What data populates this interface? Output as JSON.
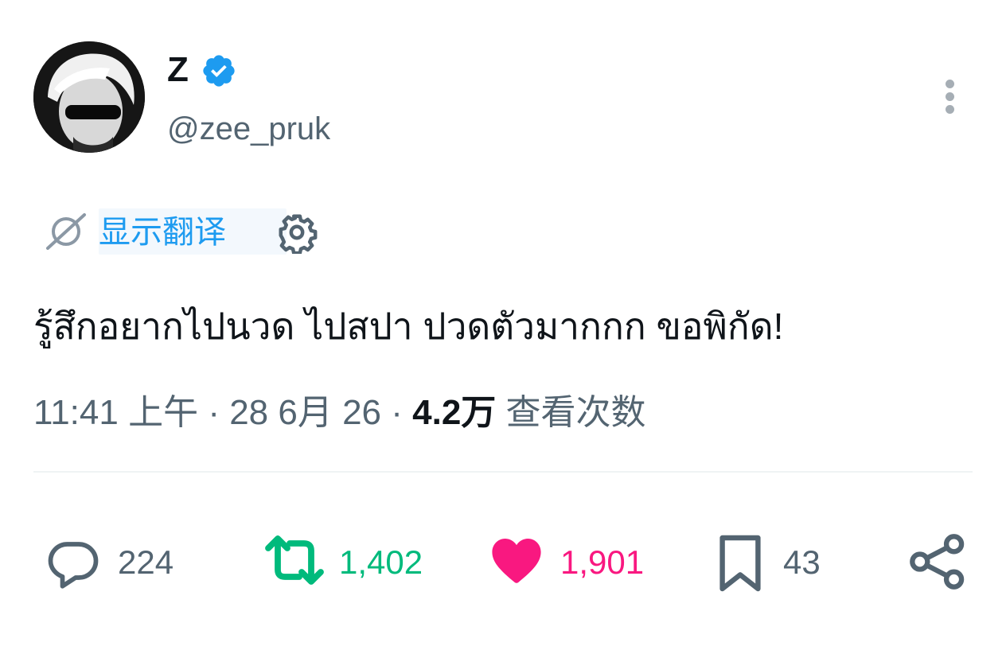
{
  "author": {
    "display_name": "Z",
    "handle": "@zee_pruk",
    "verified": true,
    "verified_icon": "verified-badge-icon"
  },
  "translate": {
    "label": "显示翻译",
    "icon": "translate-icon",
    "settings_icon": "gear-icon"
  },
  "tweet": {
    "text": "รู้สึกอยากไปนวด ไปสปา ปวดตัวมากกก ขอพิกัด!"
  },
  "meta": {
    "time": "11:41 上午",
    "separator": "·",
    "date": "28 6月 26",
    "views_count": "4.2万",
    "views_label": "查看次数"
  },
  "actions": {
    "reply_count": "224",
    "retweet_count": "1,402",
    "like_count": "1,901",
    "bookmark_count": "43"
  },
  "colors": {
    "accent": "#1d9bf0",
    "retweet": "#00ba7c",
    "like": "#f91880",
    "secondary_text": "#536471"
  }
}
